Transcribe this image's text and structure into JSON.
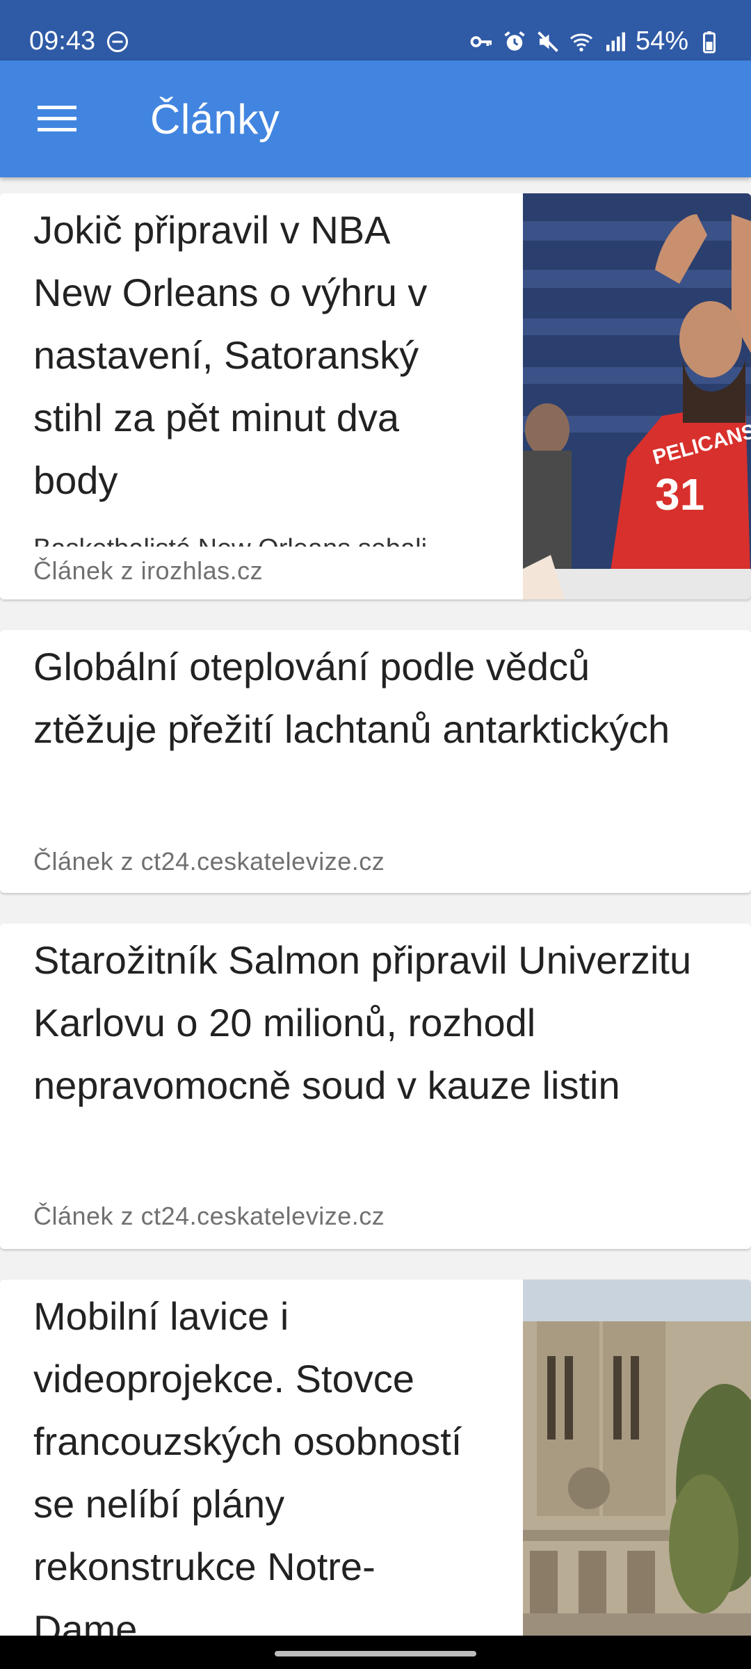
{
  "status_bar": {
    "time": "09:43",
    "battery": "54%",
    "icons": [
      "do-not-disturb-icon",
      "vpn-key-icon",
      "alarm-icon",
      "mute-icon",
      "wifi-icon",
      "signal-icon",
      "battery-icon"
    ]
  },
  "app_bar": {
    "title": "Články",
    "menu_icon": "hamburger-menu-icon"
  },
  "articles": [
    {
      "title": "Jokič připravil v NBA New Orleans o výhru v nastavení, Satoranský stihl za pět minut dva body",
      "snippet": "Basketbalisté New Orleans sebali",
      "source": "Článek z irozhlas.cz",
      "has_thumbnail": true,
      "thumbnail": "basketball-player-photo"
    },
    {
      "title": "Globální oteplování podle vědců ztěžuje přežití lachtanů antarktických",
      "source": "Článek z ct24.ceskatelevize.cz",
      "has_thumbnail": false
    },
    {
      "title": "Starožitník Salmon připravil Univerzitu Karlovu o 20 milionů, rozhodl nepravomocně soud v kauze listin",
      "source": "Článek z ct24.ceskatelevize.cz",
      "has_thumbnail": false
    },
    {
      "title": "Mobilní lavice i videoprojekce. Stovce francouzských osobností se nelíbí plány rekonstrukce Notre-Dame",
      "has_thumbnail": true,
      "thumbnail": "notre-dame-photo"
    }
  ],
  "colors": {
    "status_bar": "#2f5aa6",
    "app_bar": "#4285e0",
    "background": "#f2f2f2",
    "card": "#ffffff",
    "source_text": "#707070"
  }
}
